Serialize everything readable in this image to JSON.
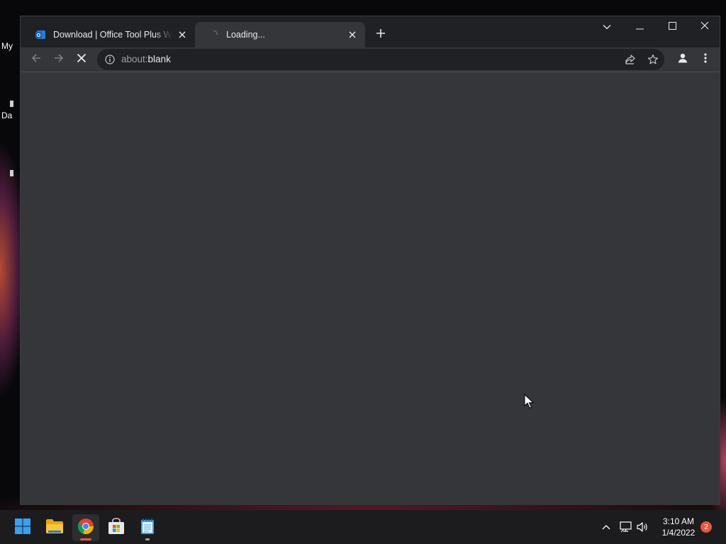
{
  "desktop": {
    "icon_labels": [
      "My",
      "Da"
    ]
  },
  "browser": {
    "tabs": [
      {
        "title": "Download | Office Tool Plus Website",
        "active": false,
        "favicon": "office-tool-plus-icon"
      },
      {
        "title": "Loading...",
        "active": true,
        "favicon": "loading-spinner-icon"
      }
    ],
    "window_controls": [
      "tab-search-icon",
      "minimize-icon",
      "maximize-icon",
      "close-icon"
    ],
    "address": {
      "scheme": "about:",
      "rest": "blank"
    },
    "toolbar_icons": [
      "back-icon",
      "forward-icon",
      "stop-loading-icon",
      "site-info-icon",
      "share-icon",
      "bookmark-star-icon",
      "profile-icon",
      "menu-icon"
    ]
  },
  "taskbar": {
    "apps": [
      "start-icon",
      "file-explorer-icon",
      "chrome-icon",
      "microsoft-store-icon",
      "notepad-icon"
    ],
    "tray": [
      "show-hidden-icons-chevron",
      "network-icon",
      "volume-icon"
    ],
    "clock": {
      "time": "3:10 AM",
      "date": "1/4/2022"
    },
    "notification_count": "2"
  },
  "colors": {
    "window_frame": "#202124",
    "toolbar": "#35363a",
    "content": "#35363a",
    "taskbar": "#1c1c1f",
    "notification_badge": "#e8573f"
  }
}
